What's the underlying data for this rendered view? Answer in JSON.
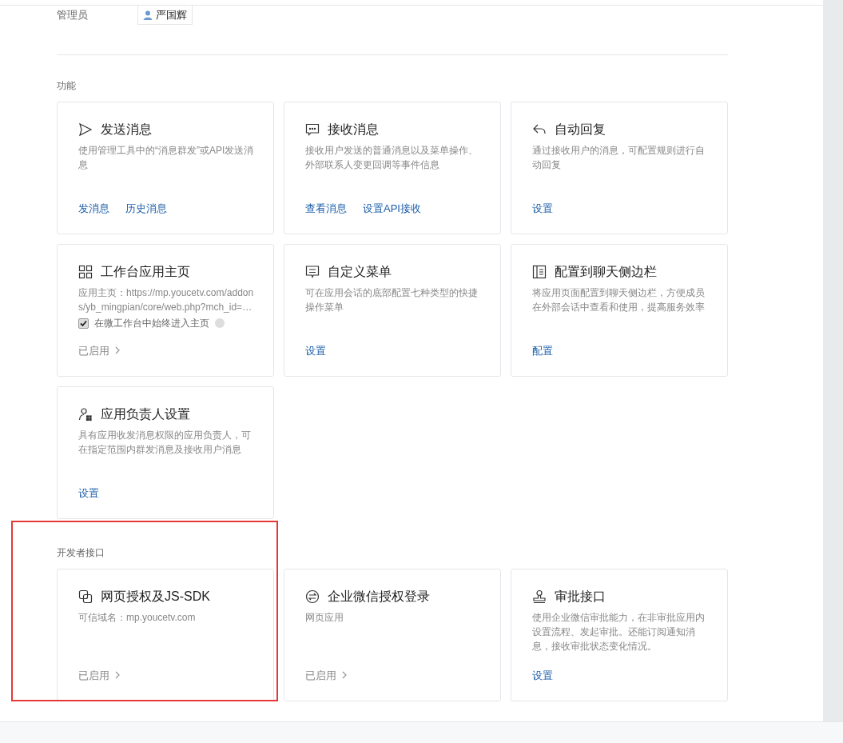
{
  "admin": {
    "label": "管理员",
    "name": "严国辉"
  },
  "sections": [
    {
      "title": "功能",
      "highlighted": false,
      "cards": [
        {
          "kind": "send",
          "title": "发送消息",
          "description": "使用管理工具中的“消息群发”或API发送消息",
          "footer": {
            "kind": "links",
            "links": [
              "发消息",
              "历史消息"
            ]
          }
        },
        {
          "kind": "chat",
          "title": "接收消息",
          "description": "接收用户发送的普通消息以及菜单操作、外部联系人变更回调等事件信息",
          "footer": {
            "kind": "links",
            "links": [
              "查看消息",
              "设置API接收"
            ]
          }
        },
        {
          "kind": "reply",
          "title": "自动回复",
          "description": "通过接收用户的消息，可配置规则进行自动回复",
          "footer": {
            "kind": "links",
            "links": [
              "设置"
            ]
          }
        },
        {
          "kind": "grid",
          "title": "工作台应用主页",
          "description": "应用主页：https://mp.youcetv.com/addons/yb_mingpian/core/web.php?mch_id=…",
          "checkbox": {
            "label": "在微工作台中始终进入主页",
            "checked": true
          },
          "footer": {
            "kind": "status",
            "text": "已启用"
          }
        },
        {
          "kind": "menu",
          "title": "自定义菜单",
          "description": "可在应用会话的底部配置七种类型的快捷操作菜单",
          "footer": {
            "kind": "links",
            "links": [
              "设置"
            ]
          }
        },
        {
          "kind": "sidebar",
          "title": "配置到聊天侧边栏",
          "description": "将应用页面配置到聊天侧边栏，方便成员在外部会话中查看和使用，提高服务效率",
          "footer": {
            "kind": "links",
            "links": [
              "配置"
            ]
          }
        },
        {
          "kind": "person",
          "title": "应用负责人设置",
          "description": "具有应用收发消息权限的应用负责人，可在指定范围内群发消息及接收用户消息",
          "footer": {
            "kind": "links",
            "links": [
              "设置"
            ]
          }
        }
      ]
    },
    {
      "title": "开发者接口",
      "highlighted": true,
      "cards": [
        {
          "kind": "copy",
          "title": "网页授权及JS-SDK",
          "description": "可信域名：mp.youcetv.com",
          "footer": {
            "kind": "status",
            "text": "已启用"
          }
        },
        {
          "kind": "swap",
          "title": "企业微信授权登录",
          "description": "网页应用",
          "footer": {
            "kind": "status",
            "text": "已启用"
          }
        },
        {
          "kind": "stamp",
          "title": "审批接口",
          "description": "使用企业微信审批能力，在非审批应用内设置流程、发起审批。还能订阅通知消息，接收审批状态变化情况。",
          "footer": {
            "kind": "links",
            "links": [
              "设置"
            ]
          }
        }
      ]
    }
  ]
}
